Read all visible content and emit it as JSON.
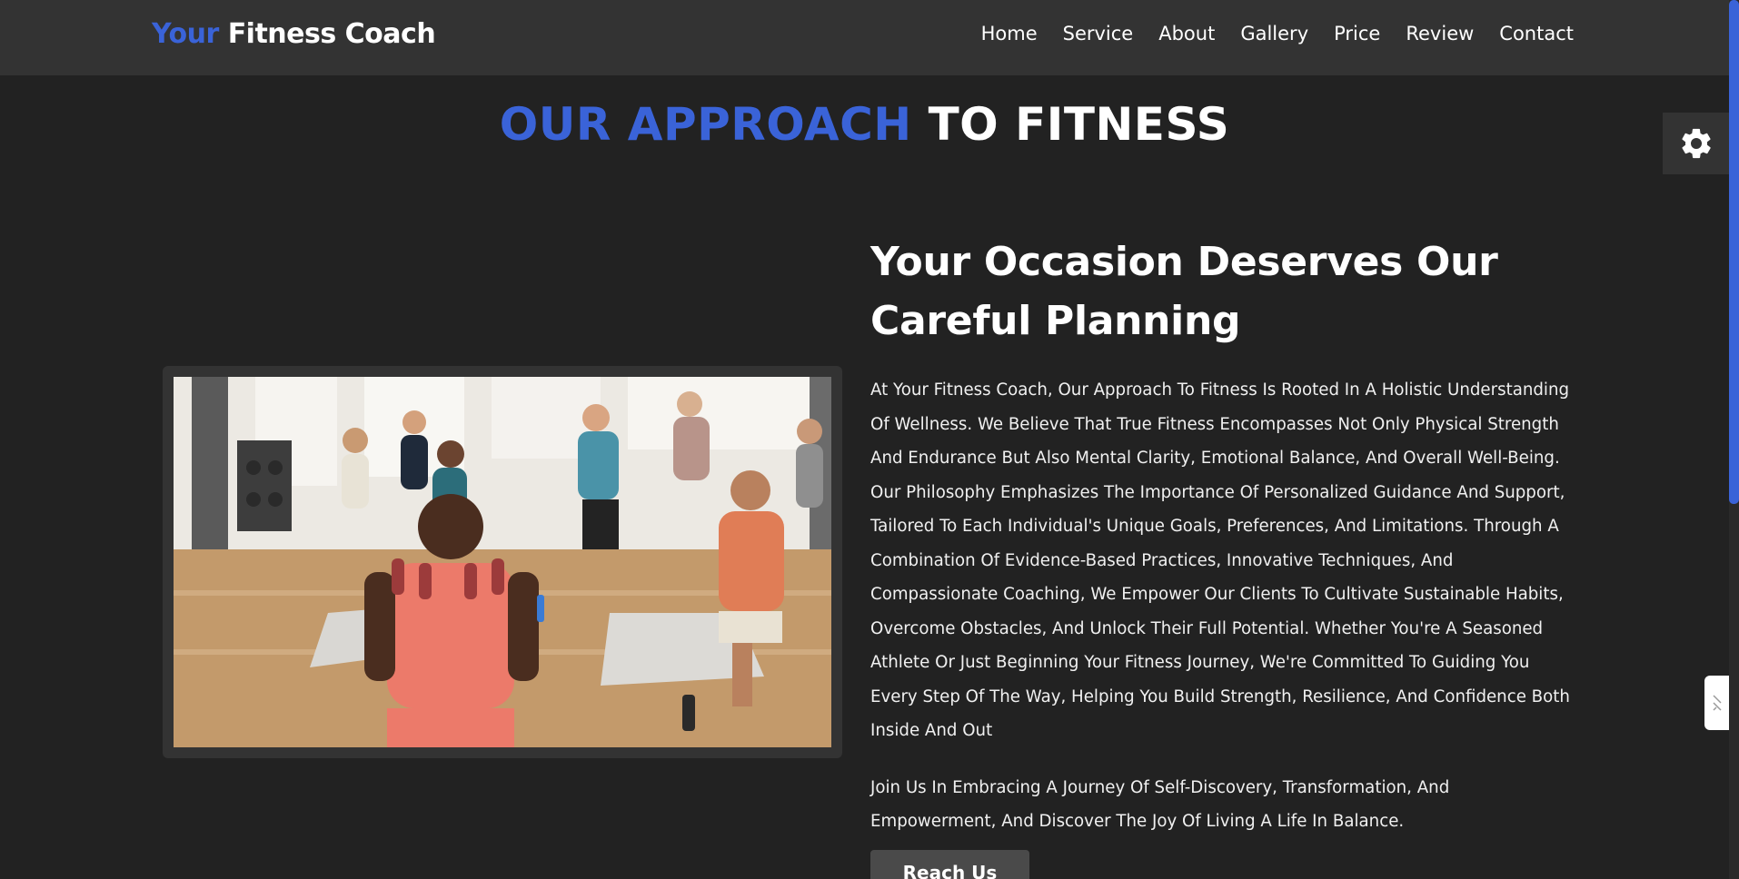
{
  "header": {
    "logo_accent": "Your",
    "logo_rest": "Fitness Coach",
    "nav": [
      "Home",
      "Service",
      "About",
      "Gallery",
      "Price",
      "Review",
      "Contact"
    ]
  },
  "section": {
    "heading_accent": "OUR APPROACH",
    "heading_rest": "TO FITNESS"
  },
  "content": {
    "title": "Your Occasion Deserves Our Careful Planning",
    "paragraph1": "At Your Fitness Coach, Our Approach To Fitness Is Rooted In A Holistic Understanding Of Wellness. We Believe That True Fitness Encompasses Not Only Physical Strength And Endurance But Also Mental Clarity, Emotional Balance, And Overall Well-Being. Our Philosophy Emphasizes The Importance Of Personalized Guidance And Support, Tailored To Each Individual's Unique Goals, Preferences, And Limitations. Through A Combination Of Evidence-Based Practices, Innovative Techniques, And Compassionate Coaching, We Empower Our Clients To Cultivate Sustainable Habits, Overcome Obstacles, And Unlock Their Full Potential. Whether You're A Seasoned Athlete Or Just Beginning Your Fitness Journey, We're Committed To Guiding You Every Step Of The Way, Helping You Build Strength, Resilience, And Confidence Both Inside And Out",
    "paragraph2": "Join Us In Embracing A Journey Of Self-Discovery, Transformation, And Empowerment, And Discover The Joy Of Living A Life In Balance.",
    "button_label": "Reach Us"
  },
  "icons": {
    "settings": "gear-icon",
    "side_widget": "grip-icon"
  },
  "colors": {
    "accent": "#3a63d8",
    "background": "#222222",
    "header": "#333333"
  }
}
